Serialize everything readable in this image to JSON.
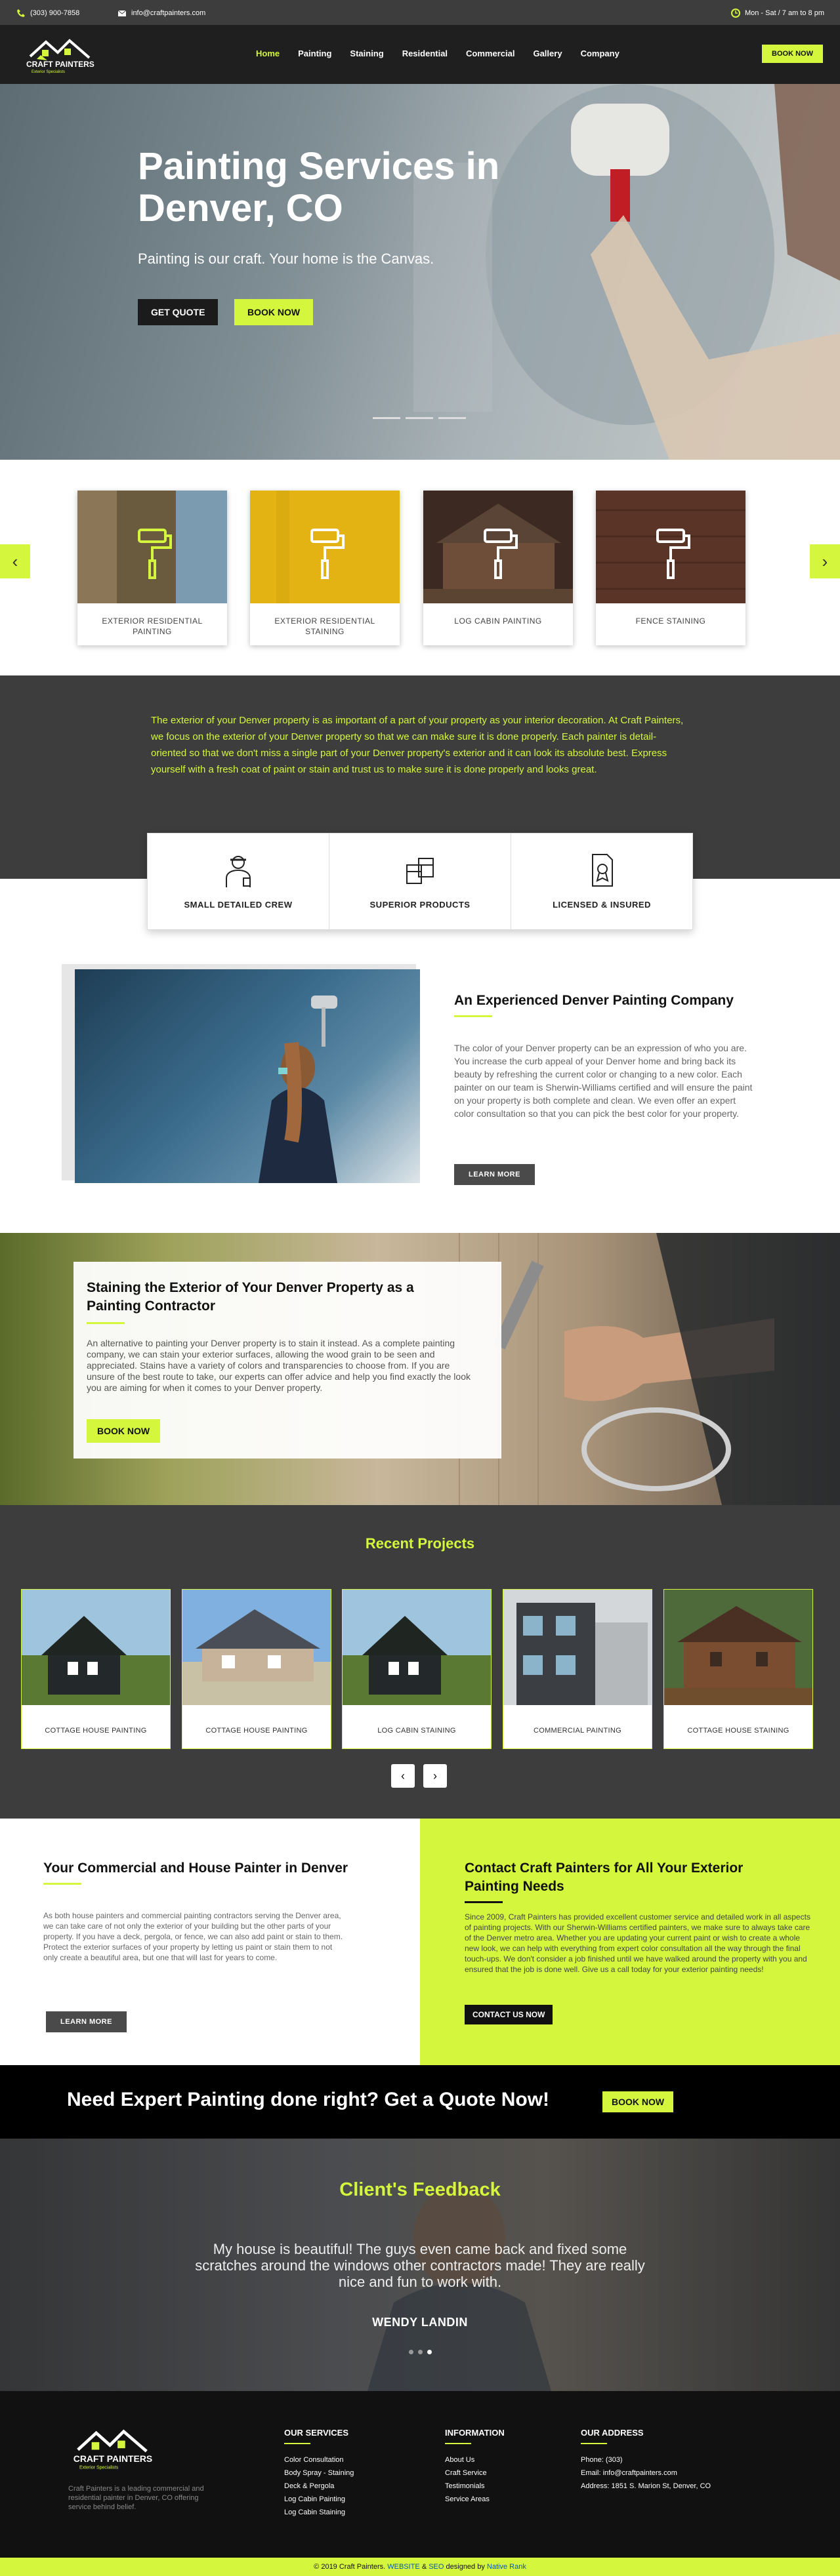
{
  "topbar": {
    "phone": "(303) 900-7858",
    "email": "info@craftpainters.com",
    "hours": "Mon - Sat / 7 am to 8 pm"
  },
  "brand": {
    "name": "CRAFT PAINTERS",
    "tagline": "Exterior Specialists"
  },
  "nav": {
    "items": [
      "Home",
      "Painting",
      "Staining",
      "Residential",
      "Commercial",
      "Gallery",
      "Company"
    ],
    "active": "Home",
    "book": "BOOK NOW"
  },
  "hero": {
    "title": "Painting Services in Denver, CO",
    "subtitle": "Painting is our craft. Your home is the Canvas.",
    "quote": "GET QUOTE",
    "book": "BOOK NOW"
  },
  "services": [
    "EXTERIOR RESIDENTIAL PAINTING",
    "EXTERIOR RESIDENTIAL STAINING",
    "LOG CABIN PAINTING",
    "FENCE STAINING"
  ],
  "intro": {
    "text": "The exterior of your Denver property is as important of a part of your property as your interior decoration. At Craft Painters, we focus on the exterior of your Denver property so that we can make sure it is done properly. Each painter is detail-oriented so that we don't miss a single part of your Denver property's exterior and it can look its absolute best. Express yourself with a fresh coat of paint or stain and trust us to make sure it is done properly and looks great."
  },
  "features": [
    "SMALL DETAILED CREW",
    "SUPERIOR PRODUCTS",
    "LICENSED & INSURED"
  ],
  "experienced": {
    "title": "An Experienced Denver Painting Company",
    "text": "The color of your Denver property can be an expression of who you are. You increase the curb appeal of your Denver home and bring back its beauty by refreshing the current color or changing to a new color. Each painter on our team is Sherwin-Williams certified and will ensure the paint on your property is both complete and clean. We even offer an expert color consultation so that you can pick the best color for your property.",
    "button": "LEARN MORE"
  },
  "staining": {
    "title": "Staining the Exterior of Your Denver Property as a Painting Contractor",
    "text": "An alternative to painting your Denver property is to stain it instead. As a complete painting company, we can stain your exterior surfaces, allowing the wood grain to be seen and appreciated. Stains have a variety of colors and transparencies to choose from. If you are unsure of the best route to take, our experts can offer advice and help you find exactly the look you are aiming for when it comes to your Denver property.",
    "button": "BOOK NOW"
  },
  "projects": {
    "title": "Recent Projects",
    "items": [
      "COTTAGE HOUSE PAINTING",
      "COTTAGE HOUSE PAINTING",
      "LOG CABIN STAINING",
      "COMMERCIAL PAINTING",
      "COTTAGE HOUSE STAINING"
    ]
  },
  "commercial": {
    "title": "Your Commercial and House Painter in Denver",
    "text": "As both house painters and commercial painting contractors serving the Denver area, we can take care of not only the exterior of your building but the other parts of your property. If you have a deck, pergola, or fence, we can also add paint or stain to them. Protect the exterior surfaces of your property by letting us paint or stain them to not only create a beautiful area, but one that will last for years to come.",
    "button": "LEARN MORE"
  },
  "contact": {
    "title": "Contact Craft Painters for All Your Exterior Painting Needs",
    "text": "Since 2009, Craft Painters has provided excellent customer service and detailed work in all aspects of painting projects. With our Sherwin-Williams certified painters, we make sure to always take care of the Denver metro area. Whether you are updating your current paint or wish to create a whole new look, we can help with everything from expert color consultation all the way through the final touch-ups. We don't consider a job finished until we have walked around the property with you and ensured that the job is done well. Give us a call today for your exterior painting needs!",
    "button": "CONTACT US NOW"
  },
  "quote": {
    "title": "Need Expert Painting done right? Get a Quote Now!",
    "button": "BOOK NOW"
  },
  "feedback": {
    "title": "Client's Feedback",
    "text": "My house is beautiful! The guys even came back and fixed some scratches around the windows other contractors made! They are really nice and fun to work with.",
    "name": "WENDY LANDIN"
  },
  "footer": {
    "about": "Craft Painters is a leading commercial and residential painter in Denver, CO offering service behind belief.",
    "services": {
      "title": "OUR SERVICES",
      "items": [
        "Color Consultation",
        "Body Spray - Staining",
        "Deck & Pergola",
        "Log Cabin Painting",
        "Log Cabin Staining"
      ]
    },
    "info": {
      "title": "INFORMATION",
      "items": [
        "About Us",
        "Craft Service",
        "Testimonials",
        "Service Areas"
      ]
    },
    "address": {
      "title": "OUR ADDRESS",
      "items": [
        "Phone: (303)",
        "Email: info@craftpainters.com",
        "Address: 1851 S. Marion St, Denver, CO"
      ]
    },
    "copyright": "© 2019 Craft Painters.",
    "website": "WEBSITE",
    "amp": "&",
    "seo": "SEO",
    "designed": "designed by",
    "designer": "Native Rank"
  },
  "colors": {
    "accent": "#d4f73d",
    "dark": "#3d3d3d",
    "black": "#111111"
  }
}
